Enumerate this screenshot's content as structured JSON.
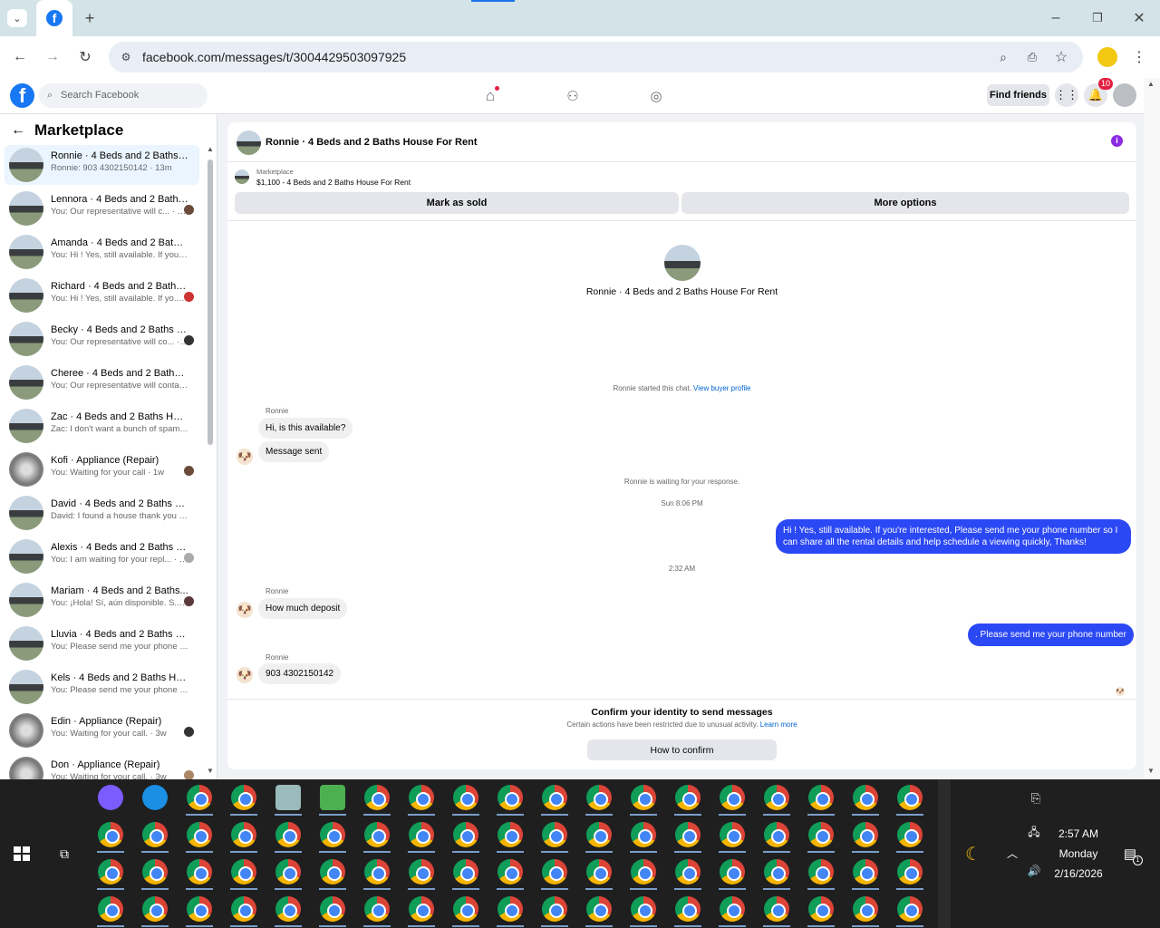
{
  "browser": {
    "url": "facebook.com/messages/t/3004429503097925",
    "tab_icon": "facebook-icon"
  },
  "fb_header": {
    "search_placeholder": "Search Facebook",
    "find_friends": "Find friends",
    "notifications_count": "10"
  },
  "sidebar": {
    "title": "Marketplace",
    "conversations": [
      {
        "title": "Ronnie · 4 Beds and 2 Baths Ho...",
        "preview": "Ronnie: 903 4302150142 · 13m"
      },
      {
        "title": "Lennora · 4 Beds and 2 Baths...",
        "preview": "You: Our representative will c... · 46m"
      },
      {
        "title": "Amanda · 4 Beds and 2 Baths H...",
        "preview": "You: Hi ! Yes, still available. If you'r... · 1h"
      },
      {
        "title": "Richard · 4 Beds and 2 Baths ...",
        "preview": "You: Hi ! Yes, still available. If yo... · 1h"
      },
      {
        "title": "Becky · 4 Beds and 2 Baths H...",
        "preview": "You: Our representative will co... · 1h"
      },
      {
        "title": "Cheree · 4 Beds and 2 Baths Ho...",
        "preview": "You: Our representative will conta... · 1w"
      },
      {
        "title": "Zac · 4 Beds and 2 Baths House...",
        "preview": "Zac: I don't want a bunch of spam... · 1w"
      },
      {
        "title": "Kofi · Appliance (Repair)",
        "preview": "You: Waiting for your call · 1w"
      },
      {
        "title": "David · 4 Beds and 2 Baths Hou...",
        "preview": "David: I found a house thank you · 2w"
      },
      {
        "title": "Alexis · 4 Beds and 2 Baths H...",
        "preview": "You: I am waiting for your repl... · 2w"
      },
      {
        "title": "Mariam · 4 Beds and 2 Baths...",
        "preview": "You: ¡Hola! Sí, aún disponible. S... · 2w"
      },
      {
        "title": "Lluvia · 4 Beds and 2 Baths Hou...",
        "preview": "You: Please send me your phone ... · 3w"
      },
      {
        "title": "Kels · 4 Beds and 2 Baths Hous...",
        "preview": "You: Please send me your phone ... · 3w"
      },
      {
        "title": "Edin · Appliance (Repair)",
        "preview": "You: Waiting for your call. · 3w"
      },
      {
        "title": "Don · Appliance (Repair)",
        "preview": "You: Waiting for your call. · 3w"
      }
    ]
  },
  "chat": {
    "title": "Ronnie · 4 Beds and 2 Baths House For Rent",
    "listing_label": "Marketplace",
    "listing_price": "$1,100 - 4 Beds and 2 Baths House For Rent",
    "mark_sold": "Mark as sold",
    "more_options": "More options",
    "profile_name": "Ronnie · 4 Beds and 2 Baths House For Rent",
    "started_text": "Ronnie started this chat.",
    "view_buyer": "View buyer profile",
    "sender_name": "Ronnie",
    "msg1": "Hi, is this available?",
    "msg2": "Message sent",
    "waiting_text": "Ronnie is waiting for your response.",
    "time1": "Sun 8:06 PM",
    "out1": "Hi ! Yes, still available. If you're interested, Please send me your phone number so I can share all the rental details and help schedule a viewing quickly, Thanks!",
    "time2": "2:32 AM",
    "msg3": "How much deposit",
    "out2": ". Please send me your phone number",
    "msg4": "903 4302150142",
    "confirm_title": "Confirm your identity to send messages",
    "confirm_sub": "Certain actions have been restricted due to unusual activity.",
    "learn_more": "Learn more",
    "how_to_confirm": "How to confirm"
  },
  "taskbar": {
    "time": "2:57 AM",
    "day": "Monday",
    "date": "2/16/2026",
    "notif_count": "1"
  }
}
